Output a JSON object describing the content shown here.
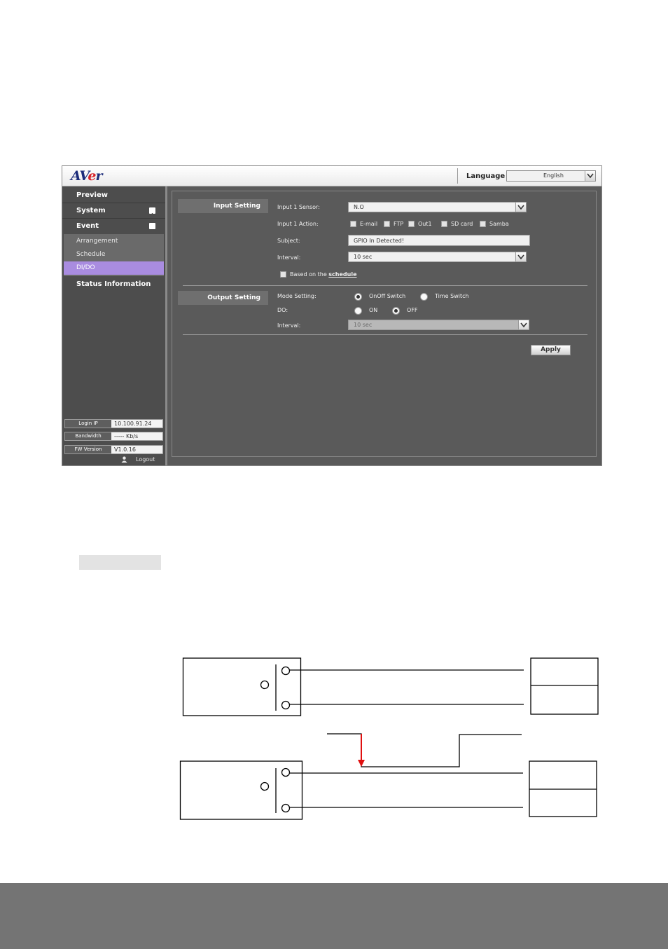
{
  "header": {
    "logo_text": "AVer",
    "language_label": "Language",
    "language_value": "English"
  },
  "sidebar": {
    "items": [
      {
        "label": "Preview"
      },
      {
        "label": "System",
        "expander": "plus"
      },
      {
        "label": "Event",
        "expander": "minus"
      }
    ],
    "event_submenu": [
      {
        "label": "Arrangement"
      },
      {
        "label": "Schedule"
      },
      {
        "label": "DI/DO",
        "active": true
      }
    ],
    "status_label": "Status Information",
    "info": [
      {
        "key": "Login IP",
        "value": "10.100.91.24"
      },
      {
        "key": "Bandwidth",
        "value": "----- Kb/s"
      },
      {
        "key": "FW Version",
        "value": "V1.0.16"
      }
    ],
    "logout_label": "Logout"
  },
  "input_setting": {
    "header": "Input Setting",
    "sensor_label": "Input 1 Sensor:",
    "sensor_value": "N.O",
    "action_label": "Input 1 Action:",
    "actions": [
      "E-mail",
      "FTP",
      "Out1",
      "SD card",
      "Samba"
    ],
    "subject_label": "Subject:",
    "subject_value": "GPIO In Detected!",
    "interval_label": "Interval:",
    "interval_value": "10 sec",
    "schedule_prefix": "Based on the",
    "schedule_link": "schedule"
  },
  "output_setting": {
    "header": "Output Setting",
    "mode_label": "Mode Setting:",
    "mode_options": [
      "OnOff Switch",
      "Time Switch"
    ],
    "mode_selected": "OnOff Switch",
    "do_label": "DO:",
    "do_options": [
      "ON",
      "OFF"
    ],
    "do_selected": "OFF",
    "interval_label": "Interval:",
    "interval_value": "10 sec"
  },
  "apply_label": "Apply",
  "colors": {
    "sidebar_active": "#a98ce0",
    "panel_bg": "#5a5a5a",
    "logo_blue": "#1c2c7a",
    "logo_red": "#d8232a",
    "diagram_arrow": "#e01010"
  }
}
